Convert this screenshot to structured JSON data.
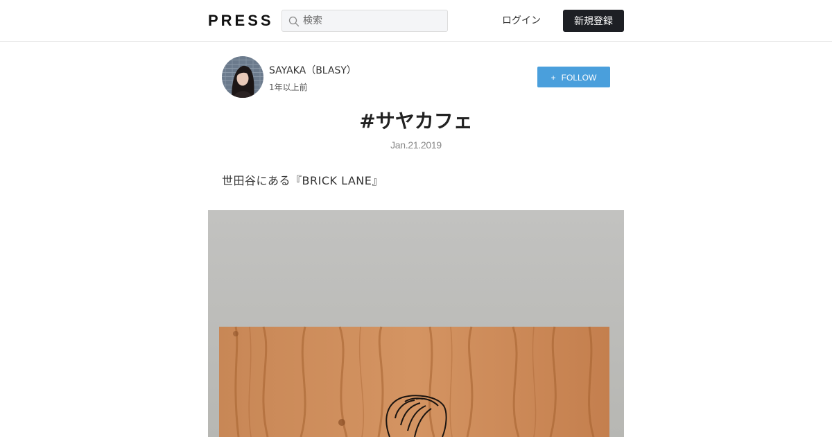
{
  "header": {
    "logo": "PRESS",
    "search_placeholder": "検索",
    "login_label": "ログイン",
    "signup_label": "新規登録"
  },
  "author": {
    "name": "SAYAKA（BLASY）",
    "posted": "1年以上前",
    "follow_label": "FOLLOW",
    "follow_icon": "+"
  },
  "article": {
    "title": "#サヤカフェ",
    "date": "Jan.21.2019",
    "body": "世田谷にある『BRICK LANE』"
  },
  "colors": {
    "accent": "#4a9fdc",
    "dark_button": "#1d1f24",
    "border": "#e3e3e3"
  }
}
